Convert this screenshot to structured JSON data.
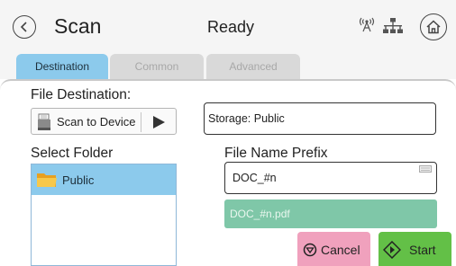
{
  "header": {
    "title": "Scan",
    "status": "Ready",
    "icons": [
      "back-icon",
      "wireless-icon",
      "network-icon",
      "home-icon"
    ]
  },
  "tabs": [
    {
      "label": "Destination",
      "active": true
    },
    {
      "label": "Common",
      "active": false
    },
    {
      "label": "Advanced",
      "active": false
    }
  ],
  "destination": {
    "file_destination_label": "File Destination:",
    "device_button_label": "Scan to Device",
    "storage_value": "Storage: Public"
  },
  "folders": {
    "label": "Select Folder",
    "items": [
      {
        "label": "Public",
        "selected": true
      }
    ]
  },
  "file_name": {
    "label": "File Name Prefix",
    "value": "DOC_#n",
    "preview": "DOC_#n.pdf"
  },
  "actions": {
    "cancel_label": "Cancel",
    "start_label": "Start"
  },
  "colors": {
    "tab_active": "#8ccaec",
    "tab_inactive": "#d9d9d9",
    "preview": "#7fc7a8",
    "cancel": "#f0a1bd",
    "start": "#63c047"
  }
}
